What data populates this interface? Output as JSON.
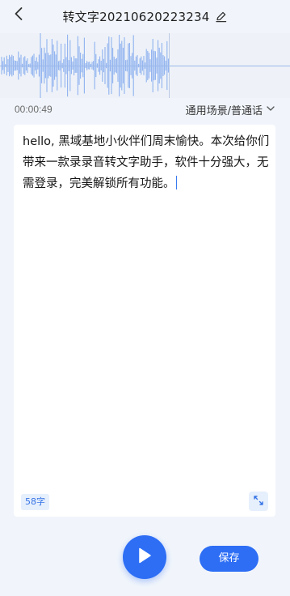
{
  "header": {
    "title": "转文字20210620223234",
    "back_icon": "back-chevron-icon",
    "edit_icon": "pencil-edit-icon"
  },
  "player": {
    "elapsed": "00:00:49",
    "scene_label": "通用场景/普通话",
    "scene_icon": "chevron-down-icon",
    "wave_color": "#8fb2ef"
  },
  "transcript": {
    "text": "hello, 黑域基地小伙伴们周末愉快。本次给你们带来一款录录音转文字助手，软件十分强大，无需登录，完美解锁所有功能。",
    "char_count": "58字",
    "expand_icon": "expand-arrows-icon"
  },
  "controls": {
    "play_icon": "play-icon",
    "save_label": "保存",
    "accent": "#2d6ef5"
  }
}
